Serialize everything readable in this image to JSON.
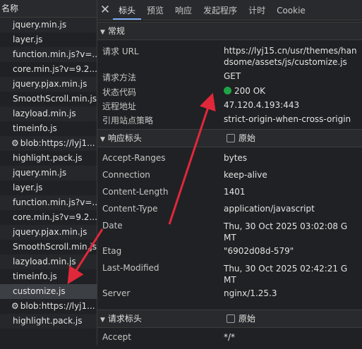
{
  "left": {
    "header": "名称",
    "files": [
      {
        "label": "jquery.min.js",
        "gear": false
      },
      {
        "label": "layer.js",
        "gear": false
      },
      {
        "label": "function.min.js?v=...",
        "gear": false
      },
      {
        "label": "core.min.js?v=9.2...",
        "gear": false
      },
      {
        "label": "jquery.pjax.min.js",
        "gear": false
      },
      {
        "label": "SmoothScroll.min.js",
        "gear": false
      },
      {
        "label": "lazyload.min.js",
        "gear": false
      },
      {
        "label": "timeinfo.js",
        "gear": false
      },
      {
        "label": "blob:https://lyj1...",
        "gear": true
      },
      {
        "label": "highlight.pack.js",
        "gear": false
      },
      {
        "label": "jquery.min.js",
        "gear": false
      },
      {
        "label": "layer.js",
        "gear": false
      },
      {
        "label": "function.min.js?v=...",
        "gear": false
      },
      {
        "label": "core.min.js?v=9.2...",
        "gear": false
      },
      {
        "label": "jquery.pjax.min.js",
        "gear": false
      },
      {
        "label": "SmoothScroll.min.js",
        "gear": false
      },
      {
        "label": "lazyload.min.js",
        "gear": false
      },
      {
        "label": "timeinfo.js",
        "gear": false
      },
      {
        "label": "customize.js",
        "gear": false,
        "selected": true
      },
      {
        "label": "blob:https://lyj1...",
        "gear": true
      },
      {
        "label": "highlight.pack.js",
        "gear": false
      }
    ]
  },
  "tabs": [
    "标头",
    "预览",
    "响应",
    "发起程序",
    "计时",
    "Cookie"
  ],
  "general": {
    "title": "常规",
    "rows": [
      {
        "k": "请求 URL",
        "v": "https://lyj15.cn/usr/themes/handsome/assets/js/customize.js"
      },
      {
        "k": "请求方法",
        "v": "GET"
      },
      {
        "k": "状态代码",
        "v": "200 OK"
      },
      {
        "k": "远程地址",
        "v": "47.120.4.193:443"
      },
      {
        "k": "引用站点策略",
        "v": "strict-origin-when-cross-origin"
      }
    ]
  },
  "response_headers": {
    "title": "响应标头",
    "raw_label": "原始",
    "rows": [
      {
        "k": "Accept-Ranges",
        "v": "bytes"
      },
      {
        "k": "Connection",
        "v": "keep-alive"
      },
      {
        "k": "Content-Length",
        "v": "1401"
      },
      {
        "k": "Content-Type",
        "v": "application/javascript"
      },
      {
        "k": "Date",
        "v": "Thu, 30 Oct 2025 03:02:08 GMT"
      },
      {
        "k": "Etag",
        "v": "\"6902d08d-579\""
      },
      {
        "k": "Last-Modified",
        "v": "Thu, 30 Oct 2025 02:42:21 GMT"
      },
      {
        "k": "Server",
        "v": "nginx/1.25.3"
      }
    ]
  },
  "request_headers": {
    "title": "请求标头",
    "raw_label": "原始",
    "rows": [
      {
        "k": "Accept",
        "v": "*/*"
      }
    ]
  },
  "colors": {
    "status_dot": "#1ea446",
    "annotation": "#e0283a",
    "active_tab": "#7cacf8"
  }
}
